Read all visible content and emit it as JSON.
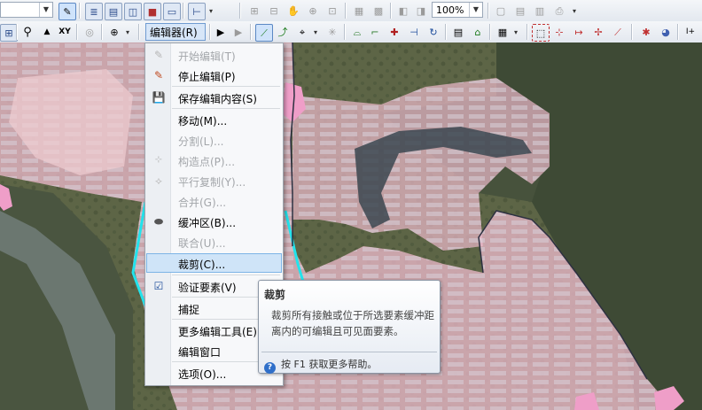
{
  "toolbar_top": {
    "scale_combo_value": "",
    "zoom_combo_value": "100%"
  },
  "toolbar_editor": {
    "editor_label": "编辑器(R)",
    "editor_arrow": "▾"
  },
  "editor_menu": {
    "items": [
      {
        "label": "开始编辑(T)",
        "enabled": false,
        "icon": "pencil-icon"
      },
      {
        "label": "停止编辑(P)",
        "enabled": true,
        "icon": "stop-pencil-icon"
      },
      {
        "label": "保存编辑内容(S)",
        "enabled": true,
        "icon": "save-icon"
      },
      {
        "label": "移动(M)...",
        "enabled": true,
        "icon": ""
      },
      {
        "label": "分割(L)...",
        "enabled": false,
        "icon": ""
      },
      {
        "label": "构造点(P)...",
        "enabled": false,
        "icon": "construct-points-icon"
      },
      {
        "label": "平行复制(Y)...",
        "enabled": false,
        "icon": "copy-parallel-icon"
      },
      {
        "label": "合并(G)...",
        "enabled": false,
        "icon": ""
      },
      {
        "label": "缓冲区(B)...",
        "enabled": true,
        "icon": "buffer-icon"
      },
      {
        "label": "联合(U)...",
        "enabled": false,
        "icon": ""
      },
      {
        "label": "裁剪(C)...",
        "enabled": true,
        "icon": "",
        "highlighted": true
      },
      {
        "label": "验证要素(V)",
        "enabled": true,
        "icon": "validate-icon"
      },
      {
        "label": "捕捉",
        "enabled": true,
        "icon": ""
      },
      {
        "label": "更多编辑工具(E)",
        "enabled": true,
        "icon": ""
      },
      {
        "label": "编辑窗口",
        "enabled": true,
        "icon": ""
      },
      {
        "label": "选项(O)...",
        "enabled": true,
        "icon": ""
      }
    ]
  },
  "tooltip": {
    "title": "裁剪",
    "body": "裁剪所有接触或位于所选要素缓冲距离内的可编辑且可见面要素。",
    "help": "按 F1 获取更多帮助。"
  },
  "colors": {
    "highlight_bg": "#cfe4f8",
    "highlight_border": "#7db4e6",
    "polygon_fill": "#e9b7c8",
    "selection_cyan": "#23e3ec"
  }
}
